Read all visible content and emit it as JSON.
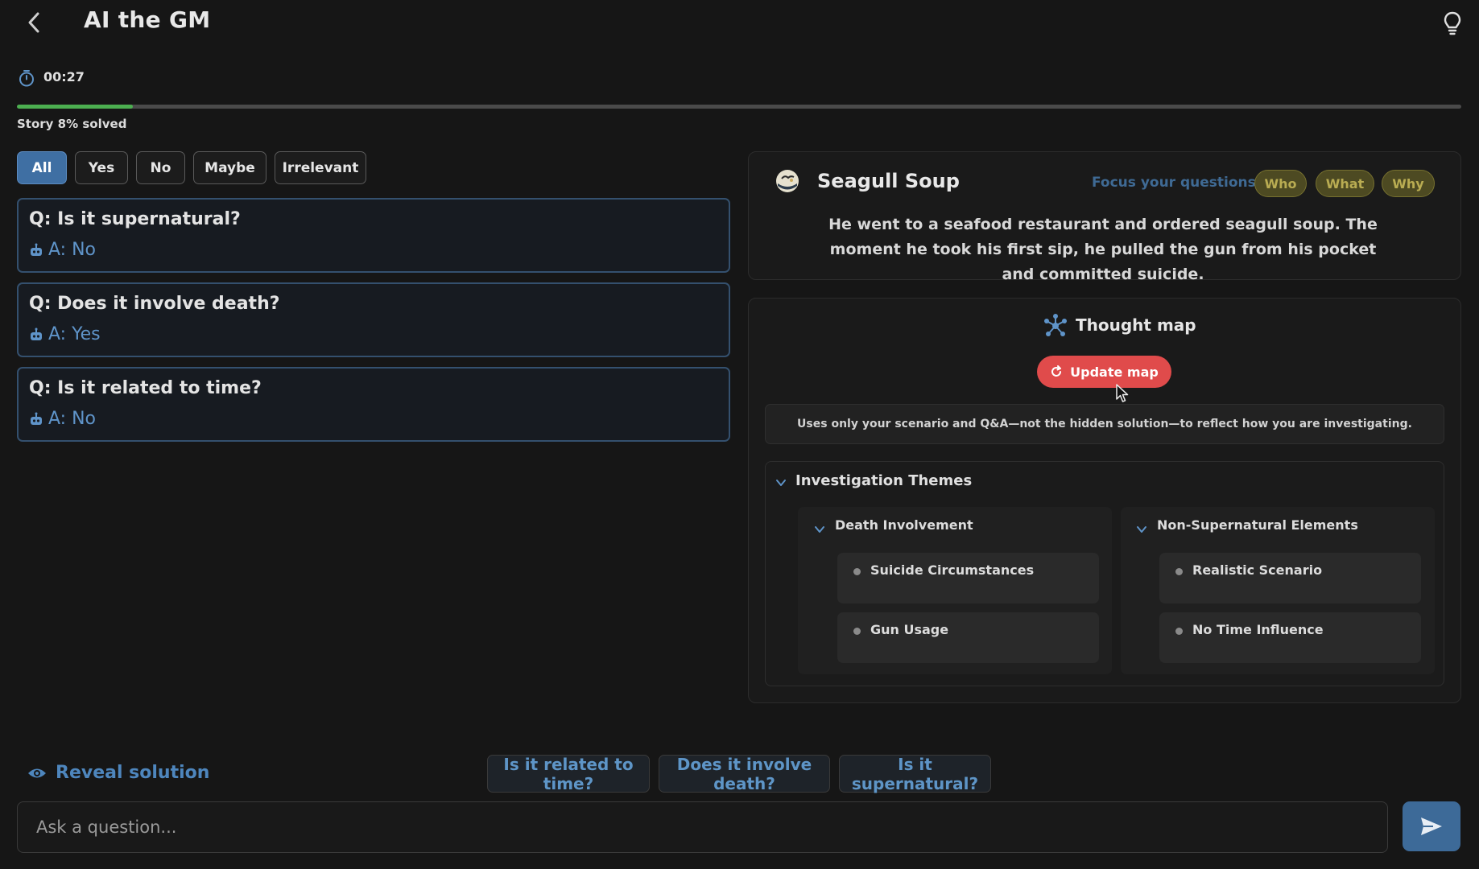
{
  "header": {
    "title": "AI the GM"
  },
  "timer": {
    "value": "00:27"
  },
  "progress": {
    "percent": 8,
    "label": "Story 8% solved",
    "color": "#4caf50"
  },
  "filters": [
    {
      "label": "All",
      "active": true
    },
    {
      "label": "Yes",
      "active": false
    },
    {
      "label": "No",
      "active": false
    },
    {
      "label": "Maybe",
      "active": false
    },
    {
      "label": "Irrelevant",
      "active": false
    }
  ],
  "qa": [
    {
      "q": "Q: Is it supernatural?",
      "a": "A: No"
    },
    {
      "q": "Q: Does it involve death?",
      "a": "A: Yes"
    },
    {
      "q": "Q: Is it related to time?",
      "a": "A: No"
    }
  ],
  "story": {
    "title": "Seagull Soup",
    "focus_label": "Focus your questions on:",
    "focus_chips": [
      "Who",
      "What",
      "Why"
    ],
    "text": "He went to a seafood restaurant and ordered seagull soup. The moment he took his first sip, he pulled the gun from his pocket and committed suicide."
  },
  "thought_map": {
    "title": "Thought map",
    "update_label": "Update map",
    "note": "Uses only your scenario and Q&A—not the hidden solution—to reflect how you are investigating.",
    "themes_title": "Investigation Themes",
    "groups": [
      {
        "title": "Death Involvement",
        "items": [
          "Suicide Circumstances",
          "Gun Usage"
        ]
      },
      {
        "title": "Non-Supernatural Elements",
        "items": [
          "Realistic Scenario",
          "No Time Influence"
        ]
      }
    ]
  },
  "bottom": {
    "reveal_label": "Reveal solution",
    "suggestions": [
      "Is it related to time?",
      "Does it involve death?",
      "Is it supernatural?"
    ],
    "input_placeholder": "Ask a question..."
  },
  "colors": {
    "accent_blue": "#3f6fa3",
    "update_red": "#e04b4b",
    "chip_olive": "#4d4a22",
    "progress_green": "#4caf50"
  },
  "icons": [
    "back-chevron-icon",
    "lightbulb-icon",
    "stopwatch-icon",
    "robot-icon",
    "story-logo-icon",
    "network-icon",
    "refresh-icon",
    "chevron-down-icon",
    "eye-icon",
    "send-icon",
    "mouse-cursor-icon"
  ]
}
